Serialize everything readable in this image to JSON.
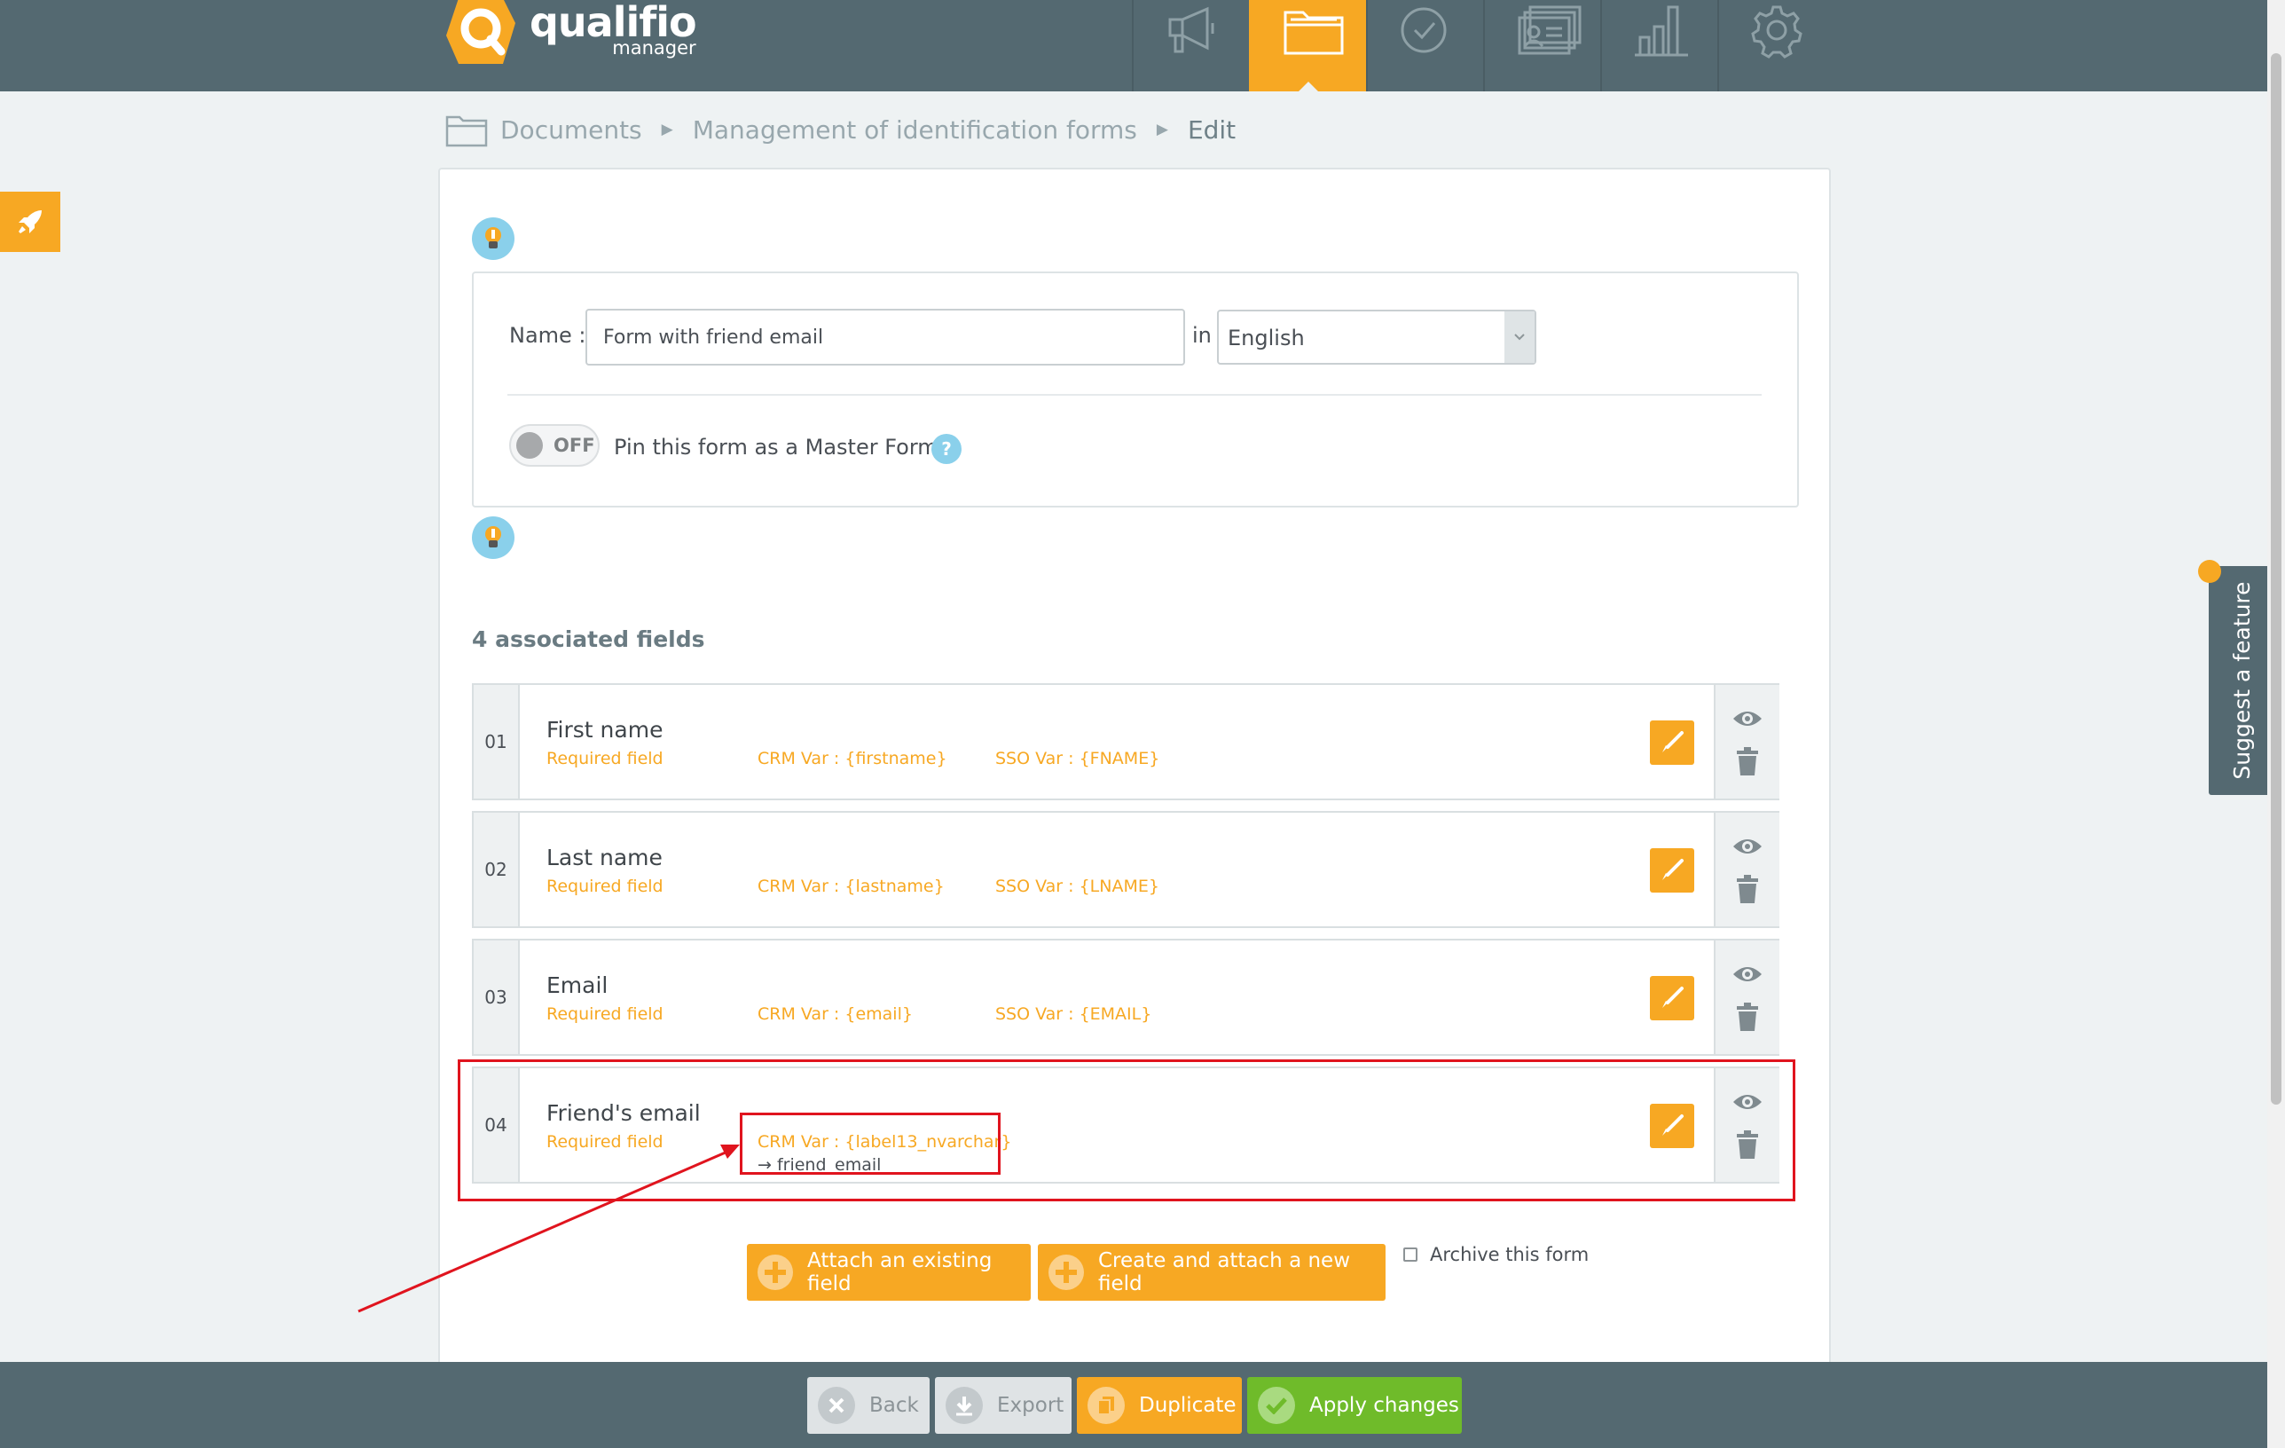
{
  "app": {
    "logo_name": "qualifio",
    "logo_sub": "manager"
  },
  "topnav": {
    "items": [
      {
        "icon": "megaphone-icon"
      },
      {
        "icon": "folder-icon",
        "active": true
      },
      {
        "icon": "check-circle-icon"
      },
      {
        "icon": "id-cards-icon"
      },
      {
        "icon": "bar-chart-icon"
      },
      {
        "icon": "gear-icon"
      }
    ]
  },
  "breadcrumb": {
    "items": [
      "Documents",
      "Management of identification forms",
      "Edit"
    ]
  },
  "form": {
    "name_label": "Name :",
    "name_value": "Form with friend email",
    "in_label": "in",
    "language": "English",
    "toggle_state": "OFF",
    "pin_label": "Pin this form as a Master Form",
    "help": "?"
  },
  "fields": {
    "title": "4 associated fields",
    "rows": [
      {
        "num": "01",
        "name": "First name",
        "required": "Required field",
        "crm": "CRM Var : {firstname}",
        "sso": "SSO Var : {FNAME}"
      },
      {
        "num": "02",
        "name": "Last name",
        "required": "Required field",
        "crm": "CRM Var : {lastname}",
        "sso": "SSO Var : {LNAME}"
      },
      {
        "num": "03",
        "name": "Email",
        "required": "Required field",
        "crm": "CRM Var : {email}",
        "sso": "SSO Var : {EMAIL}"
      },
      {
        "num": "04",
        "name": "Friend's email",
        "required": "Required field",
        "crm": "CRM Var : {label13_nvarchar}",
        "sub": "→ friend_email"
      }
    ]
  },
  "actions": {
    "attach_existing": "Attach an existing field",
    "create_new": "Create and attach a new field",
    "archive": "Archive this form"
  },
  "bottombar": {
    "back": "Back",
    "export": "Export",
    "duplicate": "Duplicate",
    "apply": "Apply changes"
  },
  "suggest": {
    "label": "Suggest a feature"
  },
  "colors": {
    "accent": "#f7a823",
    "header": "#546971",
    "green": "#6fbb2a",
    "highlight": "#e0141e"
  }
}
